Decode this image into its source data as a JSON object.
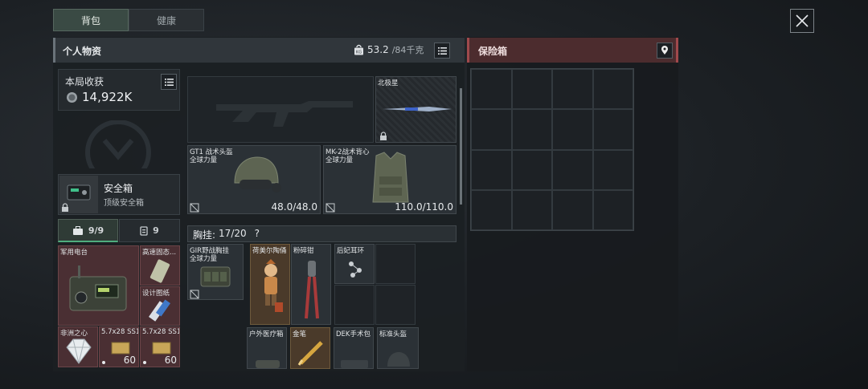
{
  "tabs": [
    {
      "label": "背包"
    },
    {
      "label": "健康"
    }
  ],
  "header": {
    "title": "个人物资",
    "weight_current": "53.2",
    "weight_max": "/84千克"
  },
  "safe_panel": {
    "title": "保险箱"
  },
  "loot": {
    "title": "本局收获",
    "value": "14,922K"
  },
  "safebox": {
    "name": "安全箱",
    "tier": "顶级安全箱"
  },
  "capacity_tabs": [
    {
      "label": "9/9"
    },
    {
      "label": "9"
    }
  ],
  "weapon_slot": {
    "north_label": "北极星"
  },
  "helmet": {
    "name": "GT1 战术头盔",
    "tag": "全球力量",
    "durability": "48.0/48.0"
  },
  "vest": {
    "name": "MK-2战术背心",
    "tag": "全球力量",
    "durability": "110.0/110.0"
  },
  "chest_rig": {
    "label": "胸挂:",
    "count": "17/20",
    "help": "?"
  },
  "chest_rig_item": {
    "name": "GIR野战胸挂",
    "tag": "全球力量"
  },
  "backpack_items": [
    {
      "name": "军用电台"
    },
    {
      "name": "高速固态..."
    },
    {
      "name": "设计图纸"
    },
    {
      "name": "非洲之心"
    },
    {
      "name": "5.7x28 SS190",
      "count": "60"
    },
    {
      "name": "5.7x28 SS190",
      "count": "60"
    }
  ],
  "rig_items": [
    {
      "name": "荷美尔陶俑"
    },
    {
      "name": "粉碎钳"
    },
    {
      "name": "后妃耳环"
    },
    {
      "name": "户外医疗箱"
    },
    {
      "name": "金笔"
    },
    {
      "name": "DEK手术包"
    },
    {
      "name": "标准头盔"
    }
  ],
  "colors": {
    "accent_safe": "#a0494c",
    "panel": "#30363b",
    "active_tab": "#3a4a44"
  }
}
